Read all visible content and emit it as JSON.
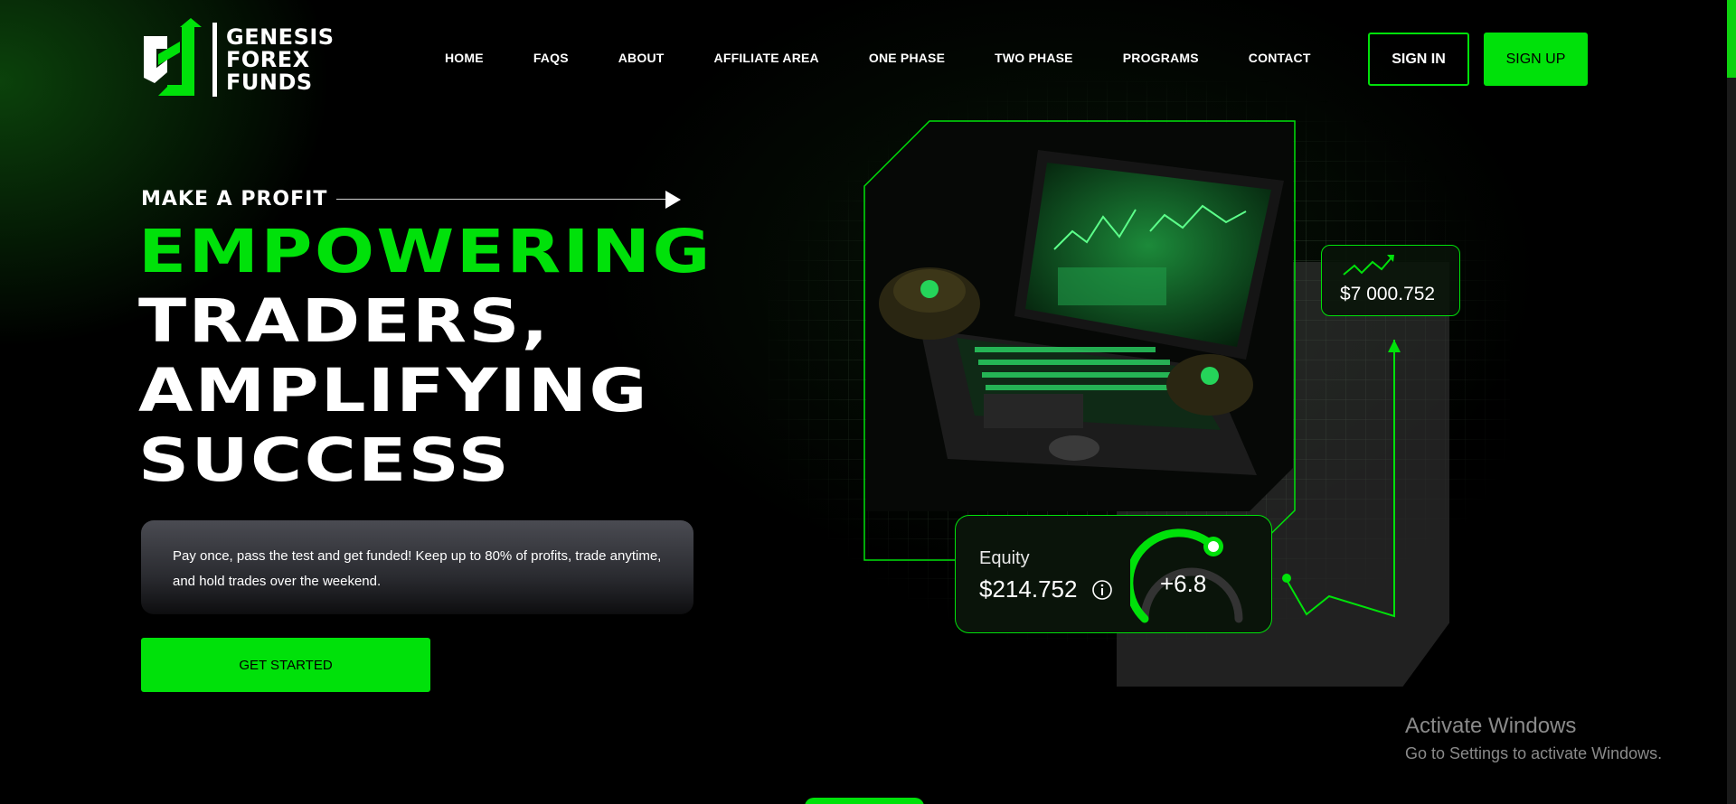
{
  "header": {
    "logo": {
      "line1": "GENESIS",
      "line2": "FOREX",
      "line3": "FUNDS"
    },
    "nav": [
      "HOME",
      "FAQS",
      "ABOUT",
      "AFFILIATE AREA",
      "ONE PHASE",
      "TWO PHASE",
      "PROGRAMS",
      "CONTACT"
    ],
    "sign_in": "SIGN IN",
    "sign_up": "SIGN UP"
  },
  "hero": {
    "kicker": "MAKE A PROFIT",
    "headline_green": "EMPOWERING",
    "headline_lines": [
      "TRADERS,",
      "AMPLIFYING",
      "SUCCESS"
    ],
    "description": "Pay once, pass the test and get funded! Keep up to 80% of profits, trade anytime, and hold trades over the weekend.",
    "cta": "GET STARTED"
  },
  "illustration": {
    "value_card": "$7 000.752",
    "equity_label": "Equity",
    "equity_value": "$214.752",
    "gauge_value": "+6.8",
    "gauge_level": 0.62
  },
  "watermark": {
    "title": "Activate Windows",
    "subtitle": "Go to Settings to activate Windows."
  },
  "colors": {
    "accent": "#00e10a",
    "background": "#000000"
  }
}
